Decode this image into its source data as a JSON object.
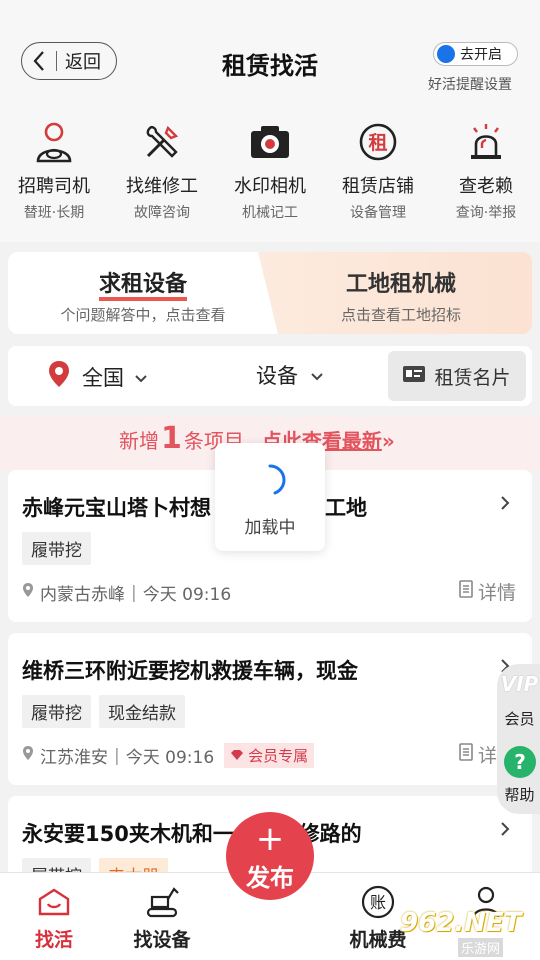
{
  "header": {
    "back_label": "返回",
    "title": "租赁找活",
    "toggle_label": "去开启",
    "remind_label": "好活提醒设置"
  },
  "quick_links": [
    {
      "title": "招聘司机",
      "sub": "替班·长期",
      "icon": "driver-icon"
    },
    {
      "title": "找维修工",
      "sub": "故障咨询",
      "icon": "tools-icon"
    },
    {
      "title": "水印相机",
      "sub": "机械记工",
      "icon": "camera-icon"
    },
    {
      "title": "租赁店铺",
      "sub": "设备管理",
      "icon": "store-icon",
      "icon_char": "租"
    },
    {
      "title": "查老赖",
      "sub": "查询·举报",
      "icon": "alarm-icon"
    }
  ],
  "category_tabs": [
    {
      "title": "求租设备",
      "sub": "个问题解答中，点击查看"
    },
    {
      "title": "工地租机械",
      "sub": "点击查看工地招标"
    }
  ],
  "filters": {
    "region": "全国",
    "equipment": "设备",
    "card_label": "租赁名片"
  },
  "banner": {
    "prefix": "新增",
    "count": "1",
    "middle": "条项目",
    "cta": "点此查看最新",
    "arrow": "»"
  },
  "loading": {
    "label": "加载中"
  },
  "listings": [
    {
      "title": "赤峰元宝山塔卜村想",
      "title_tail": "工地",
      "tags": [
        "履带挖"
      ],
      "location": "内蒙古赤峰",
      "time": "今天 09:16",
      "detail": "详情"
    },
    {
      "title": "维桥三环附近要挖机救援车辆，现金",
      "tags": [
        "履带挖",
        "现金结款"
      ],
      "location": "江苏淮安",
      "time": "今天 09:16",
      "vip": "会员专属",
      "detail": "详情"
    },
    {
      "title": "永安要150夹木机和一个150修路的",
      "tags": [
        "履带挖",
        "夹木器"
      ]
    }
  ],
  "side_float": {
    "vip": "VIP",
    "member": "会员",
    "help": "帮助"
  },
  "bottom_nav": [
    {
      "label": "找活",
      "icon": "home-icon"
    },
    {
      "label": "找设备",
      "icon": "excavator-icon"
    },
    {
      "label": "机械费",
      "icon": "ledger-icon"
    },
    {
      "label": "",
      "icon": "profile-icon"
    }
  ],
  "publish": {
    "plus": "+",
    "label": "发布"
  },
  "watermark": {
    "main": "962.NET",
    "sub": "乐游网"
  },
  "colors": {
    "accent": "#e4434d",
    "brand_red": "#d8313b",
    "help_green": "#27b36b",
    "toggle_blue": "#1a73e8"
  }
}
